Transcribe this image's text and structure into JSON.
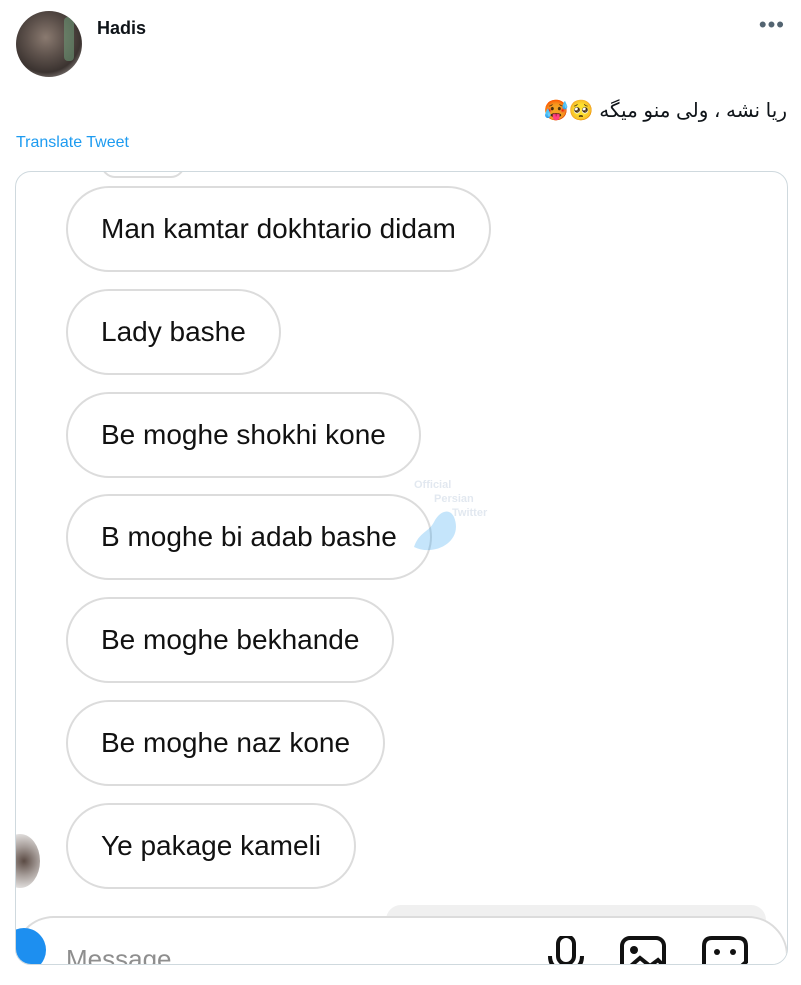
{
  "tweet": {
    "author": "Hadis",
    "more_icon": "more-horizontal-icon",
    "text": "ریا نشه ، ولی منو میگه 🥺🥵",
    "translate_label": "Translate Tweet"
  },
  "media": {
    "messages": [
      "Man kamtar dokhtario didam",
      "Lady bashe",
      "Be moghe shokhi kone",
      "B moghe bi adab bashe",
      "Be moghe bekhande",
      "Be moghe naz kone",
      "Ye pakage kameli"
    ],
    "watermark": {
      "line1": "Official",
      "line2": "Persian",
      "line3": "Twitter"
    },
    "composer": {
      "placeholder": "Message",
      "icons": [
        "camera-icon",
        "microphone-icon",
        "gallery-icon",
        "sticker-icon"
      ]
    }
  }
}
